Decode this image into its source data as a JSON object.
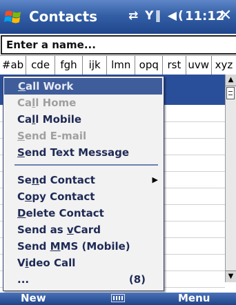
{
  "titlebar": {
    "title": "Contacts",
    "status_icons": "⇄ Y‖ ◀(",
    "time": "11:12",
    "close": "✕"
  },
  "search": {
    "value": "Enter a name..."
  },
  "abc_tabs": [
    "#ab",
    "cde",
    "fgh",
    "ijk",
    "lmn",
    "opq",
    "rst",
    "uvw",
    "xyz"
  ],
  "context_menu": {
    "items": [
      {
        "pre": "",
        "u": "C",
        "post": "all Work",
        "state": "highlighted"
      },
      {
        "pre": "Ca",
        "u": "l",
        "post": "l Home",
        "state": "disabled"
      },
      {
        "pre": "Ca",
        "u": "l",
        "post": "l Mobile",
        "state": "enabled"
      },
      {
        "pre": "",
        "u": "S",
        "post": "end E-mail",
        "state": "disabled"
      },
      {
        "pre": "",
        "u": "S",
        "post": "end Text Message",
        "state": "enabled"
      }
    ],
    "items2": [
      {
        "pre": "Se",
        "u": "n",
        "post": "d Contact",
        "state": "enabled",
        "submenu_arrow": "▶"
      },
      {
        "pre": "C",
        "u": "o",
        "post": "py Contact",
        "state": "enabled"
      },
      {
        "pre": "",
        "u": "D",
        "post": "elete Contact",
        "state": "enabled"
      },
      {
        "pre": "Send as ",
        "u": "v",
        "post": "Card",
        "state": "enabled"
      },
      {
        "pre": "Send ",
        "u": "M",
        "post": "MS (Mobile)",
        "state": "enabled"
      },
      {
        "pre": "V",
        "u": "i",
        "post": "deo Call",
        "state": "enabled"
      },
      {
        "pre": "...",
        "u": "",
        "post": "",
        "state": "enabled",
        "count": "(8)"
      }
    ]
  },
  "softkeys": {
    "left": "New",
    "right": "Menu"
  }
}
